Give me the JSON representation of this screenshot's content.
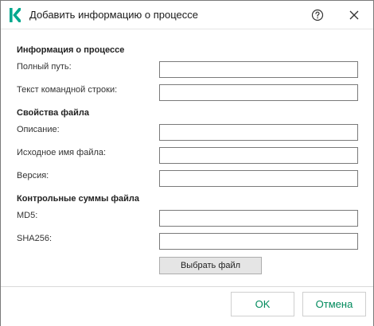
{
  "window": {
    "title": "Добавить информацию о процессе",
    "help_icon": "question-circle-icon",
    "close_icon": "close-icon",
    "logo_icon": "kaspersky-k-logo",
    "brand_color": "#00a88e"
  },
  "sections": {
    "process_info": {
      "title": "Информация о процессе",
      "full_path_label": "Полный путь:",
      "full_path_value": "",
      "command_line_label": "Текст командной строки:",
      "command_line_value": ""
    },
    "file_properties": {
      "title": "Свойства файла",
      "description_label": "Описание:",
      "description_value": "",
      "original_name_label": "Исходное имя файла:",
      "original_name_value": "",
      "version_label": "Версия:",
      "version_value": ""
    },
    "checksums": {
      "title": "Контрольные суммы файла",
      "md5_label": "MD5:",
      "md5_value": "",
      "sha256_label": "SHA256:",
      "sha256_value": "",
      "select_file_label": "Выбрать файл"
    }
  },
  "footer": {
    "ok_label": "OK",
    "cancel_label": "Отмена",
    "accent_color": "#008a5c"
  }
}
